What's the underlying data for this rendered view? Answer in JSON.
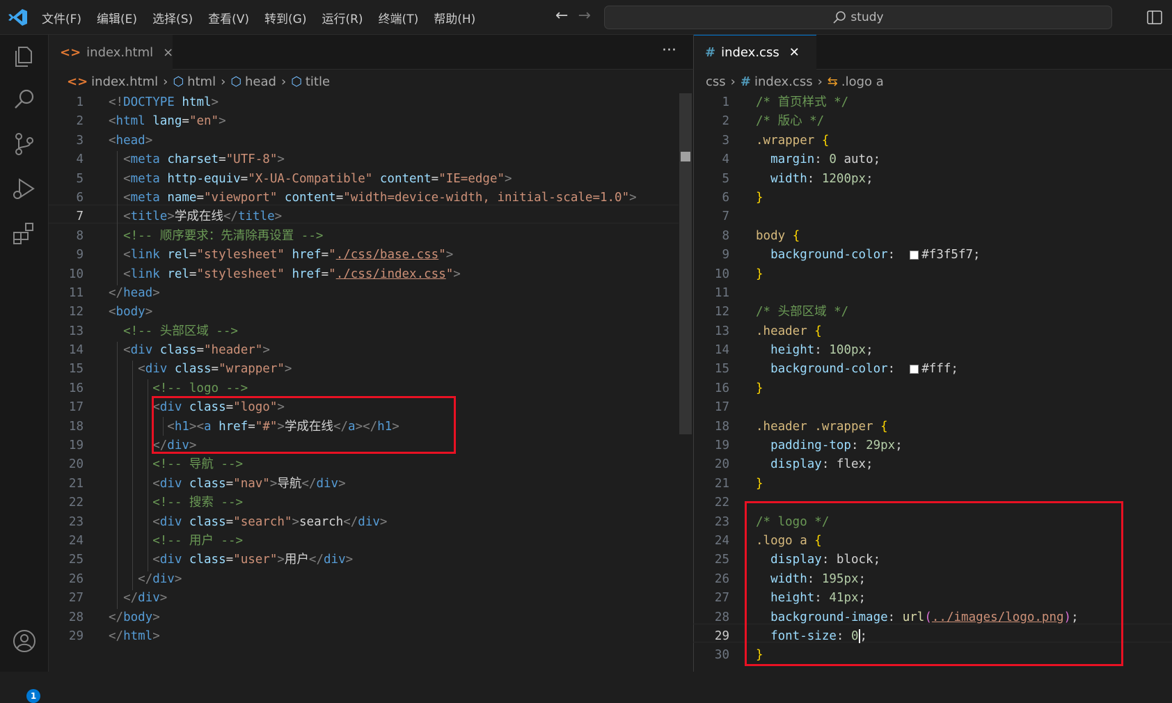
{
  "menu": [
    "文件(F)",
    "编辑(E)",
    "选择(S)",
    "查看(V)",
    "转到(G)",
    "运行(R)",
    "终端(T)",
    "帮助(H)"
  ],
  "search": {
    "text": "study"
  },
  "accounts_badge": "1",
  "left_editor": {
    "tab": {
      "name": "index.html"
    },
    "breadcrumb": [
      "index.html",
      "html",
      "head",
      "title"
    ],
    "current_line": 7,
    "lines": [
      [
        [
          "punc",
          "<!"
        ],
        [
          "tag",
          "DOCTYPE "
        ],
        [
          "attr",
          "html"
        ],
        [
          "punc",
          ">"
        ]
      ],
      [
        [
          "punc",
          "<"
        ],
        [
          "tag",
          "html "
        ],
        [
          "attr",
          "lang"
        ],
        [
          "txt",
          "="
        ],
        [
          "str",
          "\"en\""
        ],
        [
          "punc",
          ">"
        ]
      ],
      [
        [
          "punc",
          "<"
        ],
        [
          "tag",
          "head"
        ],
        [
          "punc",
          ">"
        ]
      ],
      [
        [
          "txt",
          "  "
        ],
        [
          "punc",
          "<"
        ],
        [
          "tag",
          "meta "
        ],
        [
          "attr",
          "charset"
        ],
        [
          "txt",
          "="
        ],
        [
          "str",
          "\"UTF-8\""
        ],
        [
          "punc",
          ">"
        ]
      ],
      [
        [
          "txt",
          "  "
        ],
        [
          "punc",
          "<"
        ],
        [
          "tag",
          "meta "
        ],
        [
          "attr",
          "http-equiv"
        ],
        [
          "txt",
          "="
        ],
        [
          "str",
          "\"X-UA-Compatible\" "
        ],
        [
          "attr",
          "content"
        ],
        [
          "txt",
          "="
        ],
        [
          "str",
          "\"IE=edge\""
        ],
        [
          "punc",
          ">"
        ]
      ],
      [
        [
          "txt",
          "  "
        ],
        [
          "punc",
          "<"
        ],
        [
          "tag",
          "meta "
        ],
        [
          "attr",
          "name"
        ],
        [
          "txt",
          "="
        ],
        [
          "str",
          "\"viewport\" "
        ],
        [
          "attr",
          "content"
        ],
        [
          "txt",
          "="
        ],
        [
          "str",
          "\"width=device-width, initial-scale=1.0\""
        ],
        [
          "punc",
          ">"
        ]
      ],
      [
        [
          "txt",
          "  "
        ],
        [
          "punc",
          "<"
        ],
        [
          "tag",
          "title"
        ],
        [
          "punc",
          ">"
        ],
        [
          "txt",
          "学成在线"
        ],
        [
          "punc",
          "</"
        ],
        [
          "tag",
          "title"
        ],
        [
          "punc",
          ">"
        ]
      ],
      [
        [
          "txt",
          "  "
        ],
        [
          "com",
          "<!-- 顺序要求：先清除再设置 -->"
        ]
      ],
      [
        [
          "txt",
          "  "
        ],
        [
          "punc",
          "<"
        ],
        [
          "tag",
          "link "
        ],
        [
          "attr",
          "rel"
        ],
        [
          "txt",
          "="
        ],
        [
          "str",
          "\"stylesheet\" "
        ],
        [
          "attr",
          "href"
        ],
        [
          "txt",
          "="
        ],
        [
          "str",
          "\""
        ],
        [
          "link",
          "./css/base.css"
        ],
        [
          "str",
          "\""
        ],
        [
          "punc",
          ">"
        ]
      ],
      [
        [
          "txt",
          "  "
        ],
        [
          "punc",
          "<"
        ],
        [
          "tag",
          "link "
        ],
        [
          "attr",
          "rel"
        ],
        [
          "txt",
          "="
        ],
        [
          "str",
          "\"stylesheet\" "
        ],
        [
          "attr",
          "href"
        ],
        [
          "txt",
          "="
        ],
        [
          "str",
          "\""
        ],
        [
          "link",
          "./css/index.css"
        ],
        [
          "str",
          "\""
        ],
        [
          "punc",
          ">"
        ]
      ],
      [
        [
          "punc",
          "</"
        ],
        [
          "tag",
          "head"
        ],
        [
          "punc",
          ">"
        ]
      ],
      [
        [
          "punc",
          "<"
        ],
        [
          "tag",
          "body"
        ],
        [
          "punc",
          ">"
        ]
      ],
      [
        [
          "txt",
          "  "
        ],
        [
          "com",
          "<!-- 头部区域 -->"
        ]
      ],
      [
        [
          "txt",
          "  "
        ],
        [
          "punc",
          "<"
        ],
        [
          "tag",
          "div "
        ],
        [
          "attr",
          "class"
        ],
        [
          "txt",
          "="
        ],
        [
          "str",
          "\"header\""
        ],
        [
          "punc",
          ">"
        ]
      ],
      [
        [
          "txt",
          "    "
        ],
        [
          "punc",
          "<"
        ],
        [
          "tag",
          "div "
        ],
        [
          "attr",
          "class"
        ],
        [
          "txt",
          "="
        ],
        [
          "str",
          "\"wrapper\""
        ],
        [
          "punc",
          ">"
        ]
      ],
      [
        [
          "txt",
          "      "
        ],
        [
          "com",
          "<!-- logo -->"
        ]
      ],
      [
        [
          "txt",
          "      "
        ],
        [
          "punc",
          "<"
        ],
        [
          "tag",
          "div "
        ],
        [
          "attr",
          "class"
        ],
        [
          "txt",
          "="
        ],
        [
          "str",
          "\"logo\""
        ],
        [
          "punc",
          ">"
        ]
      ],
      [
        [
          "txt",
          "        "
        ],
        [
          "punc",
          "<"
        ],
        [
          "tag",
          "h1"
        ],
        [
          "punc",
          "><"
        ],
        [
          "tag",
          "a "
        ],
        [
          "attr",
          "href"
        ],
        [
          "txt",
          "="
        ],
        [
          "str",
          "\"#\""
        ],
        [
          "punc",
          ">"
        ],
        [
          "txt",
          "学成在线"
        ],
        [
          "punc",
          "</"
        ],
        [
          "tag",
          "a"
        ],
        [
          "punc",
          "></"
        ],
        [
          "tag",
          "h1"
        ],
        [
          "punc",
          ">"
        ]
      ],
      [
        [
          "txt",
          "      "
        ],
        [
          "punc",
          "</"
        ],
        [
          "tag",
          "div"
        ],
        [
          "punc",
          ">"
        ]
      ],
      [
        [
          "txt",
          "      "
        ],
        [
          "com",
          "<!-- 导航 -->"
        ]
      ],
      [
        [
          "txt",
          "      "
        ],
        [
          "punc",
          "<"
        ],
        [
          "tag",
          "div "
        ],
        [
          "attr",
          "class"
        ],
        [
          "txt",
          "="
        ],
        [
          "str",
          "\"nav\""
        ],
        [
          "punc",
          ">"
        ],
        [
          "txt",
          "导航"
        ],
        [
          "punc",
          "</"
        ],
        [
          "tag",
          "div"
        ],
        [
          "punc",
          ">"
        ]
      ],
      [
        [
          "txt",
          "      "
        ],
        [
          "com",
          "<!-- 搜索 -->"
        ]
      ],
      [
        [
          "txt",
          "      "
        ],
        [
          "punc",
          "<"
        ],
        [
          "tag",
          "div "
        ],
        [
          "attr",
          "class"
        ],
        [
          "txt",
          "="
        ],
        [
          "str",
          "\"search\""
        ],
        [
          "punc",
          ">"
        ],
        [
          "txt",
          "search"
        ],
        [
          "punc",
          "</"
        ],
        [
          "tag",
          "div"
        ],
        [
          "punc",
          ">"
        ]
      ],
      [
        [
          "txt",
          "      "
        ],
        [
          "com",
          "<!-- 用户 -->"
        ]
      ],
      [
        [
          "txt",
          "      "
        ],
        [
          "punc",
          "<"
        ],
        [
          "tag",
          "div "
        ],
        [
          "attr",
          "class"
        ],
        [
          "txt",
          "="
        ],
        [
          "str",
          "\"user\""
        ],
        [
          "punc",
          ">"
        ],
        [
          "txt",
          "用户"
        ],
        [
          "punc",
          "</"
        ],
        [
          "tag",
          "div"
        ],
        [
          "punc",
          ">"
        ]
      ],
      [
        [
          "txt",
          "    "
        ],
        [
          "punc",
          "</"
        ],
        [
          "tag",
          "div"
        ],
        [
          "punc",
          ">"
        ]
      ],
      [
        [
          "txt",
          "  "
        ],
        [
          "punc",
          "</"
        ],
        [
          "tag",
          "div"
        ],
        [
          "punc",
          ">"
        ]
      ],
      [
        [
          "punc",
          "</"
        ],
        [
          "tag",
          "body"
        ],
        [
          "punc",
          ">"
        ]
      ],
      [
        [
          "punc",
          "</"
        ],
        [
          "tag",
          "html"
        ],
        [
          "punc",
          ">"
        ]
      ]
    ]
  },
  "right_editor": {
    "tab": {
      "name": "index.css",
      "close": "✕"
    },
    "breadcrumb": [
      "css",
      "index.css",
      ".logo a"
    ],
    "current_line": 29,
    "lines": [
      [
        [
          "com",
          "/* 首页样式 */"
        ]
      ],
      [
        [
          "com",
          "/* 版心 */"
        ]
      ],
      [
        [
          "sel",
          ".wrapper "
        ],
        [
          "brace",
          "{"
        ]
      ],
      [
        [
          "txt",
          "  "
        ],
        [
          "prop",
          "margin"
        ],
        [
          "txt",
          ": "
        ],
        [
          "num",
          "0"
        ],
        [
          "txt",
          " auto;"
        ]
      ],
      [
        [
          "txt",
          "  "
        ],
        [
          "prop",
          "width"
        ],
        [
          "txt",
          ": "
        ],
        [
          "num",
          "1200px"
        ],
        [
          "txt",
          ";"
        ]
      ],
      [
        [
          "brace",
          "}"
        ]
      ],
      [],
      [
        [
          "sel",
          "body "
        ],
        [
          "brace",
          "{"
        ]
      ],
      [
        [
          "txt",
          "  "
        ],
        [
          "prop",
          "background-color"
        ],
        [
          "txt",
          ":  "
        ],
        [
          "swatch",
          ""
        ],
        [
          "txt",
          "#f3f5f7;"
        ]
      ],
      [
        [
          "brace",
          "}"
        ]
      ],
      [],
      [
        [
          "com",
          "/* 头部区域 */"
        ]
      ],
      [
        [
          "sel",
          ".header "
        ],
        [
          "brace",
          "{"
        ]
      ],
      [
        [
          "txt",
          "  "
        ],
        [
          "prop",
          "height"
        ],
        [
          "txt",
          ": "
        ],
        [
          "num",
          "100px"
        ],
        [
          "txt",
          ";"
        ]
      ],
      [
        [
          "txt",
          "  "
        ],
        [
          "prop",
          "background-color"
        ],
        [
          "txt",
          ":  "
        ],
        [
          "swatch",
          ""
        ],
        [
          "txt",
          "#fff;"
        ]
      ],
      [
        [
          "brace",
          "}"
        ]
      ],
      [],
      [
        [
          "sel",
          ".header .wrapper "
        ],
        [
          "brace",
          "{"
        ]
      ],
      [
        [
          "txt",
          "  "
        ],
        [
          "prop",
          "padding-top"
        ],
        [
          "txt",
          ": "
        ],
        [
          "num",
          "29px"
        ],
        [
          "txt",
          ";"
        ]
      ],
      [
        [
          "txt",
          "  "
        ],
        [
          "prop",
          "display"
        ],
        [
          "txt",
          ": flex;"
        ]
      ],
      [
        [
          "brace",
          "}"
        ]
      ],
      [],
      [
        [
          "com",
          "/* logo */"
        ]
      ],
      [
        [
          "sel",
          ".logo a "
        ],
        [
          "brace",
          "{"
        ]
      ],
      [
        [
          "txt",
          "  "
        ],
        [
          "prop",
          "display"
        ],
        [
          "txt",
          ": block;"
        ]
      ],
      [
        [
          "txt",
          "  "
        ],
        [
          "prop",
          "width"
        ],
        [
          "txt",
          ": "
        ],
        [
          "num",
          "195px"
        ],
        [
          "txt",
          ";"
        ]
      ],
      [
        [
          "txt",
          "  "
        ],
        [
          "prop",
          "height"
        ],
        [
          "txt",
          ": "
        ],
        [
          "num",
          "41px"
        ],
        [
          "txt",
          ";"
        ]
      ],
      [
        [
          "txt",
          "  "
        ],
        [
          "prop",
          "background-image"
        ],
        [
          "txt",
          ": "
        ],
        [
          "fn",
          "url"
        ],
        [
          "bracep",
          "("
        ],
        [
          "link",
          "../images/logo.png"
        ],
        [
          "bracep",
          ")"
        ],
        [
          "txt",
          ";"
        ]
      ],
      [
        [
          "txt",
          "  "
        ],
        [
          "prop",
          "font-size"
        ],
        [
          "txt",
          ": "
        ],
        [
          "num",
          "0"
        ],
        [
          "cursor",
          ""
        ],
        [
          "txt",
          ";"
        ]
      ],
      [
        [
          "brace",
          "}"
        ]
      ]
    ]
  },
  "colors": {
    "accent": "#0078d4",
    "highlight_box": "#e81123"
  }
}
